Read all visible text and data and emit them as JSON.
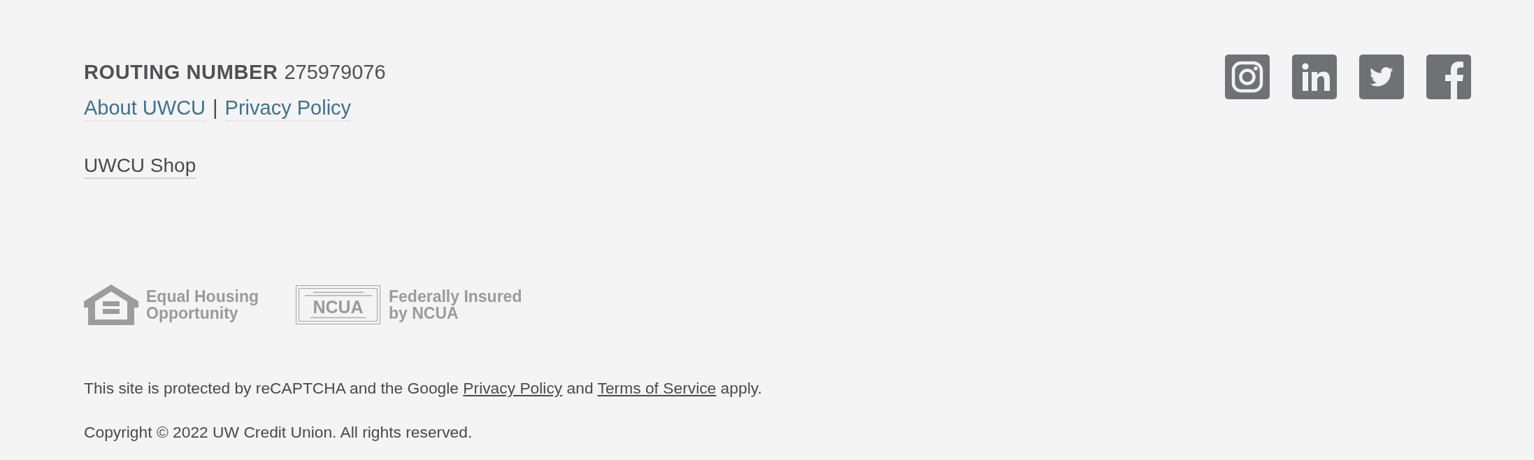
{
  "routing": {
    "label": "ROUTING NUMBER",
    "number": "275979076"
  },
  "links": [
    {
      "text": "About UWCU"
    },
    {
      "text": "Privacy Policy"
    }
  ],
  "link_separator": "|",
  "shop_link": "UWCU Shop",
  "badges": [
    {
      "kind": "equal_housing",
      "text": "Equal Housing Opportunity"
    },
    {
      "kind": "ncua",
      "seal_text": "NCUA",
      "text": "Federally Insured by NCUA"
    }
  ],
  "recaptcha_notice": [
    {
      "kind": "text",
      "text": "This site is protected by reCAPTCHA and the Google "
    },
    {
      "kind": "link",
      "text": "Privacy Policy"
    },
    {
      "kind": "text",
      "text": " and "
    },
    {
      "kind": "link",
      "text": "Terms of Service"
    },
    {
      "kind": "text",
      "text": " apply."
    }
  ],
  "copyright": "Copyright © 2022 UW Credit Union. All rights reserved.",
  "social_links": [
    {
      "kind": "instagram"
    },
    {
      "kind": "linkedin"
    },
    {
      "kind": "twitter"
    },
    {
      "kind": "facebook"
    }
  ]
}
